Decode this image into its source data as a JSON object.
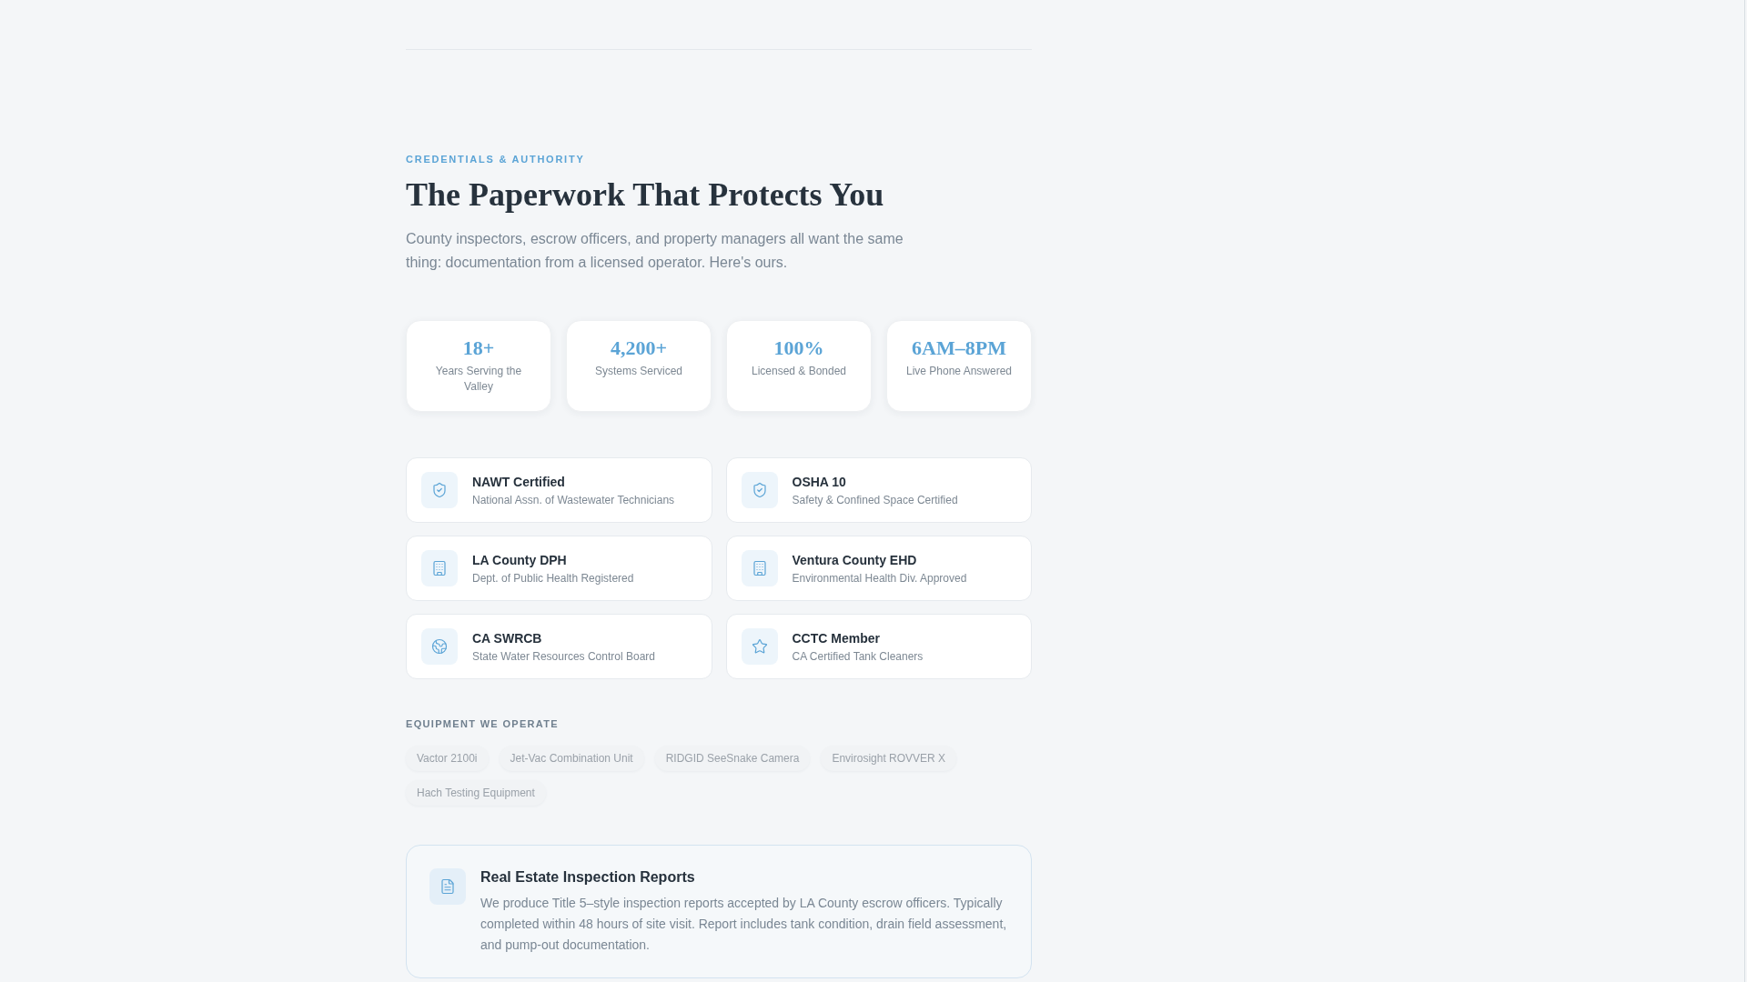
{
  "header": {
    "eyebrow": "CREDENTIALS & AUTHORITY",
    "title": "The Paperwork That Protects You",
    "intro": "County inspectors, escrow officers, and property managers all want the same thing: documentation from a licensed operator. Here's ours."
  },
  "stats": [
    {
      "value": "18+",
      "label": "Years Serving the Valley"
    },
    {
      "value": "4,200+",
      "label": "Systems Serviced"
    },
    {
      "value": "100%",
      "label": "Licensed & Bonded"
    },
    {
      "value": "6AM–8PM",
      "label": "Live Phone Answered"
    }
  ],
  "credentials": [
    {
      "kind": "shield",
      "title": "NAWT Certified",
      "subtitle": "National Assn. of Wastewater Technicians"
    },
    {
      "kind": "shield",
      "title": "OSHA 10",
      "subtitle": "Safety & Confined Space Certified"
    },
    {
      "kind": "building",
      "title": "LA County DPH",
      "subtitle": "Dept. of Public Health Registered"
    },
    {
      "kind": "building",
      "title": "Ventura County EHD",
      "subtitle": "Environmental Health Div. Approved"
    },
    {
      "kind": "globe",
      "title": "CA SWRCB",
      "subtitle": "State Water Resources Control Board"
    },
    {
      "kind": "star",
      "title": "CCTC Member",
      "subtitle": "CA Certified Tank Cleaners"
    }
  ],
  "equipment": {
    "heading": "EQUIPMENT WE OPERATE",
    "items": [
      "Vactor 2100i",
      "Jet-Vac Combination Unit",
      "RIDGID SeeSnake Camera",
      "Envirosight ROVVER X",
      "Hach Testing Equipment"
    ]
  },
  "report_card": {
    "title": "Real Estate Inspection Reports",
    "body": "We produce Title 5–style inspection reports accepted by LA County escrow officers. Typically completed within 48 hours of site visit. Report includes tank condition, drain field assessment, and pump-out documentation."
  }
}
